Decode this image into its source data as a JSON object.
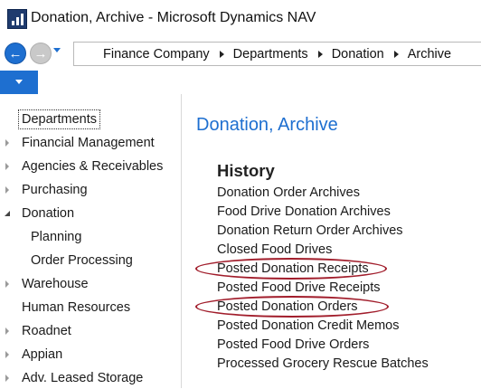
{
  "window": {
    "title": "Donation, Archive - Microsoft Dynamics NAV"
  },
  "breadcrumb": [
    "Finance Company",
    "Departments",
    "Donation",
    "Archive"
  ],
  "sidebar": {
    "items": [
      {
        "label": "Departments",
        "state": "selected"
      },
      {
        "label": "Financial Management",
        "state": "collapsed"
      },
      {
        "label": "Agencies & Receivables",
        "state": "collapsed"
      },
      {
        "label": "Purchasing",
        "state": "collapsed"
      },
      {
        "label": "Donation",
        "state": "expanded"
      },
      {
        "label": "Planning",
        "state": "sub"
      },
      {
        "label": "Order Processing",
        "state": "sub"
      },
      {
        "label": "Warehouse",
        "state": "collapsed"
      },
      {
        "label": "Human Resources",
        "state": "leaf"
      },
      {
        "label": "Roadnet",
        "state": "collapsed"
      },
      {
        "label": "Appian",
        "state": "collapsed"
      },
      {
        "label": "Adv. Leased Storage",
        "state": "collapsed"
      }
    ]
  },
  "main": {
    "page_title": "Donation, Archive",
    "section": "History",
    "links": [
      "Donation Order Archives",
      "Food Drive Donation Archives",
      "Donation Return Order Archives",
      "Closed Food Drives",
      "Posted Donation Receipts",
      "Posted Food Drive Receipts",
      "Posted Donation Orders",
      "Posted Donation Credit Memos",
      "Posted Food Drive Orders",
      "Processed Grocery Rescue Batches"
    ]
  },
  "colors": {
    "accent": "#1e6fd0",
    "annotation": "#a11d2b"
  }
}
